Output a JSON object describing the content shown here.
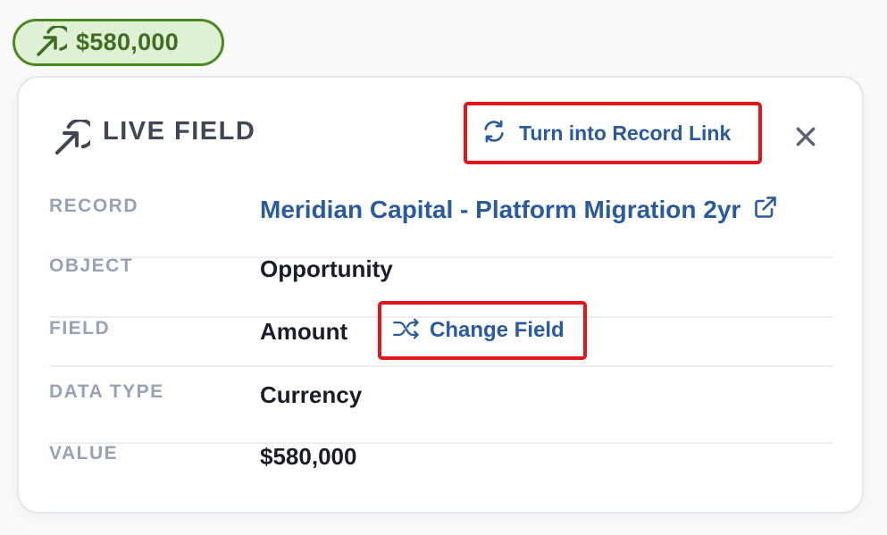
{
  "pill": {
    "value": "$580,000",
    "icon": "arrow-up-right-icon",
    "color": "#4a8a22"
  },
  "header": {
    "title": "LIVE FIELD",
    "icon": "live-field-arrow-icon",
    "record_link_button": {
      "label": "Turn into Record Link",
      "icon": "refresh-icon"
    },
    "close_icon": "close-icon"
  },
  "fields": {
    "record": {
      "label": "RECORD",
      "value": "Meridian Capital - Platform Migration 2yr",
      "icon": "external-link-icon"
    },
    "object": {
      "label": "OBJECT",
      "value": "Opportunity"
    },
    "field": {
      "label": "FIELD",
      "value": "Amount",
      "change_button": {
        "label": "Change Field",
        "icon": "shuffle-icon"
      }
    },
    "data_type": {
      "label": "DATA TYPE",
      "value": "Currency"
    },
    "value": {
      "label": "VALUE",
      "value": "$580,000"
    }
  },
  "colors": {
    "accent": "#2a5aa0",
    "highlight": "#e4141b",
    "label": "#97a2b5"
  }
}
